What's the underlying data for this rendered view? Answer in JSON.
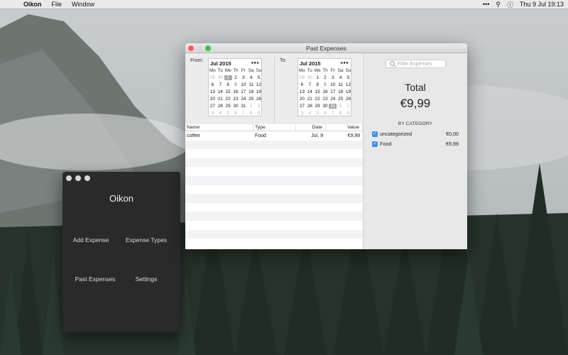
{
  "menubar": {
    "app_name": "Oikon",
    "items": [
      "File",
      "Window"
    ],
    "clock": "Thu 9 Jul  19:13"
  },
  "oikon_window": {
    "title": "Oikon",
    "buttons": {
      "add_expense": "Add Expense",
      "expense_types": "Expense Types",
      "past_expenses": "Past Expenses",
      "settings": "Settings"
    }
  },
  "past_window": {
    "title": "Past Expenses",
    "from_label": "From:",
    "to_label": "To:",
    "from_calendar": {
      "month": "Jul 2015",
      "days_of_week": [
        "Mo",
        "Tu",
        "We",
        "Th",
        "Fr",
        "Sa",
        "Su"
      ],
      "weeks": [
        [
          [
            "29",
            "other"
          ],
          [
            "30",
            "other"
          ],
          [
            "1",
            "sel"
          ],
          [
            "2",
            ""
          ],
          [
            "3",
            ""
          ],
          [
            "4",
            ""
          ],
          [
            "5",
            ""
          ]
        ],
        [
          [
            "6",
            ""
          ],
          [
            "7",
            ""
          ],
          [
            "8",
            ""
          ],
          [
            "9",
            "today"
          ],
          [
            "10",
            ""
          ],
          [
            "11",
            ""
          ],
          [
            "12",
            ""
          ]
        ],
        [
          [
            "13",
            ""
          ],
          [
            "14",
            ""
          ],
          [
            "15",
            ""
          ],
          [
            "16",
            ""
          ],
          [
            "17",
            ""
          ],
          [
            "18",
            ""
          ],
          [
            "19",
            ""
          ]
        ],
        [
          [
            "20",
            ""
          ],
          [
            "21",
            ""
          ],
          [
            "22",
            ""
          ],
          [
            "23",
            ""
          ],
          [
            "24",
            ""
          ],
          [
            "25",
            ""
          ],
          [
            "26",
            ""
          ]
        ],
        [
          [
            "27",
            ""
          ],
          [
            "28",
            ""
          ],
          [
            "29",
            ""
          ],
          [
            "30",
            ""
          ],
          [
            "31",
            ""
          ],
          [
            "1",
            "other"
          ],
          [
            "2",
            "other"
          ]
        ],
        [
          [
            "3",
            "other"
          ],
          [
            "4",
            "other"
          ],
          [
            "5",
            "other"
          ],
          [
            "6",
            "other"
          ],
          [
            "7",
            "other"
          ],
          [
            "8",
            "other"
          ],
          [
            "9",
            "other"
          ]
        ]
      ]
    },
    "to_calendar": {
      "month": "Jul 2015",
      "days_of_week": [
        "Mo",
        "Tu",
        "We",
        "Th",
        "Fr",
        "Sa",
        "Su"
      ],
      "weeks": [
        [
          [
            "29",
            "other"
          ],
          [
            "30",
            "other"
          ],
          [
            "1",
            ""
          ],
          [
            "2",
            ""
          ],
          [
            "3",
            ""
          ],
          [
            "4",
            ""
          ],
          [
            "5",
            ""
          ]
        ],
        [
          [
            "6",
            ""
          ],
          [
            "7",
            ""
          ],
          [
            "8",
            ""
          ],
          [
            "9",
            "today"
          ],
          [
            "10",
            ""
          ],
          [
            "11",
            ""
          ],
          [
            "12",
            ""
          ]
        ],
        [
          [
            "13",
            ""
          ],
          [
            "14",
            ""
          ],
          [
            "15",
            ""
          ],
          [
            "16",
            ""
          ],
          [
            "17",
            ""
          ],
          [
            "18",
            ""
          ],
          [
            "19",
            ""
          ]
        ],
        [
          [
            "20",
            ""
          ],
          [
            "21",
            ""
          ],
          [
            "22",
            ""
          ],
          [
            "23",
            ""
          ],
          [
            "24",
            ""
          ],
          [
            "25",
            ""
          ],
          [
            "26",
            ""
          ]
        ],
        [
          [
            "27",
            ""
          ],
          [
            "28",
            ""
          ],
          [
            "29",
            ""
          ],
          [
            "30",
            ""
          ],
          [
            "31",
            "sel"
          ],
          [
            "1",
            "other"
          ],
          [
            "2",
            "other"
          ]
        ],
        [
          [
            "3",
            "other"
          ],
          [
            "4",
            "other"
          ],
          [
            "5",
            "other"
          ],
          [
            "6",
            "other"
          ],
          [
            "7",
            "other"
          ],
          [
            "8",
            "other"
          ],
          [
            "9",
            "other"
          ]
        ]
      ]
    },
    "table": {
      "headers": [
        "Name",
        "Type",
        "Date",
        "Value"
      ],
      "rows": [
        [
          "coffee",
          "Food",
          "Jul, 9",
          "€9,99"
        ]
      ]
    },
    "filter": {
      "placeholder": "Filter Expenses"
    },
    "total_label": "Total",
    "total_value": "€9,99",
    "by_category_label": "BY CATEGORY",
    "categories": [
      {
        "name": "uncategorized",
        "amount": "€0,00"
      },
      {
        "name": "Food",
        "amount": "€9,99"
      }
    ]
  },
  "colors": {
    "accent": "#3d8ff5",
    "today": "#2a6fd6",
    "close": "#fc5f57",
    "minimize": "#d9d9d9",
    "zoom": "#34c84a",
    "dark_window": "#2a2a2a"
  }
}
